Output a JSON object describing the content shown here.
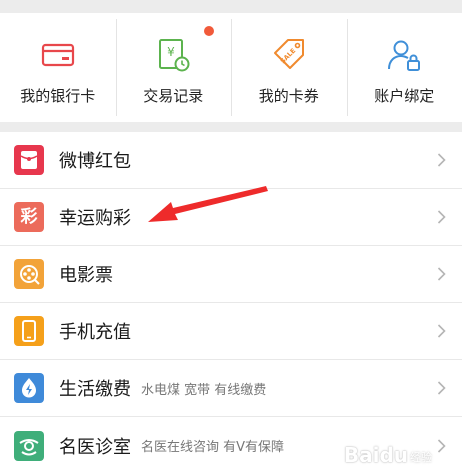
{
  "quick_actions": [
    {
      "label": "我的银行卡",
      "icon": "bank-card-icon",
      "color": "#e8474b"
    },
    {
      "label": "交易记录",
      "icon": "transaction-record-icon",
      "color": "#5cb34e"
    },
    {
      "label": "我的卡券",
      "icon": "coupon-icon",
      "color": "#f08a2e",
      "icon_text": "SALE"
    },
    {
      "label": "账户绑定",
      "icon": "account-bind-icon",
      "color": "#3f8fd8"
    }
  ],
  "notification_dot_color": "#f15a3a",
  "menu": [
    {
      "title": "微博红包",
      "subtitle": "",
      "icon": "red-envelope-icon",
      "color": "#e7374d"
    },
    {
      "title": "幸运购彩",
      "subtitle": "",
      "icon": "lottery-icon",
      "color": "#ec6b5b",
      "icon_text": "彩"
    },
    {
      "title": "电影票",
      "subtitle": "",
      "icon": "film-reel-icon",
      "color": "#f2a339"
    },
    {
      "title": "手机充值",
      "subtitle": "",
      "icon": "mobile-phone-icon",
      "color": "#f5a01a"
    },
    {
      "title": "生活缴费",
      "subtitle": "水电煤 宽带 有线缴费",
      "icon": "utility-bolt-icon",
      "color": "#3f8ad9"
    },
    {
      "title": "名医诊室",
      "subtitle": "名医在线咨询 有V有保障",
      "icon": "doctor-icon",
      "color": "#3fae7a"
    }
  ],
  "annotation_arrow_color": "#ee2b2b",
  "watermark": {
    "text": "Baidu",
    "sub": "经验"
  }
}
